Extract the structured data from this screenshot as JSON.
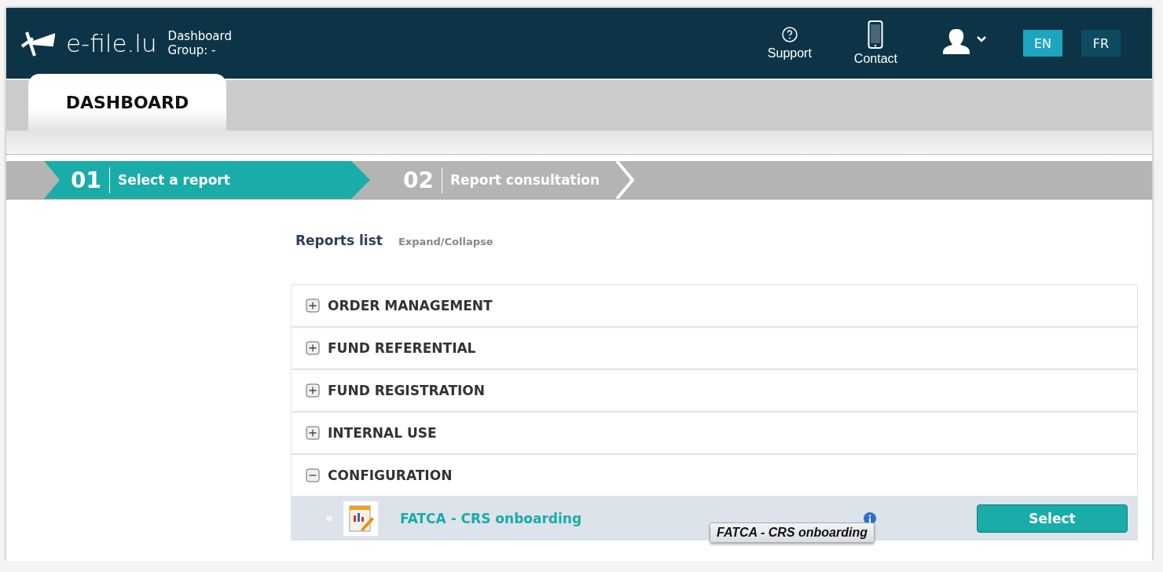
{
  "header": {
    "logo": "e-file.lu",
    "subtitle": "Dashboard",
    "group": "Group: -",
    "links": [
      {
        "kind": "support",
        "label": "Support"
      },
      {
        "kind": "contact",
        "label": "Contact"
      }
    ],
    "languages": [
      {
        "label": "EN",
        "selected": true
      },
      {
        "label": "FR",
        "selected": false
      }
    ]
  },
  "tabs": [
    {
      "label": "DASHBOARD",
      "selected": true
    }
  ],
  "steps": [
    {
      "number": "01",
      "label": "Select a report",
      "selected": true
    },
    {
      "number": "02",
      "label": "Report consultation",
      "selected": false
    }
  ],
  "reports": {
    "title": "Reports list",
    "toggle": "Expand/Collapse",
    "categories": [
      {
        "label": "ORDER MANAGEMENT",
        "expanded": false
      },
      {
        "label": "FUND REFERENTIAL",
        "expanded": false
      },
      {
        "label": "FUND REGISTRATION",
        "expanded": false
      },
      {
        "label": "INTERNAL USE",
        "expanded": false
      },
      {
        "label": "CONFIGURATION",
        "expanded": true,
        "children": [
          {
            "label": "FATCA - CRS onboarding",
            "tooltip": "FATCA - CRS onboarding",
            "button": "Select"
          }
        ]
      }
    ]
  }
}
